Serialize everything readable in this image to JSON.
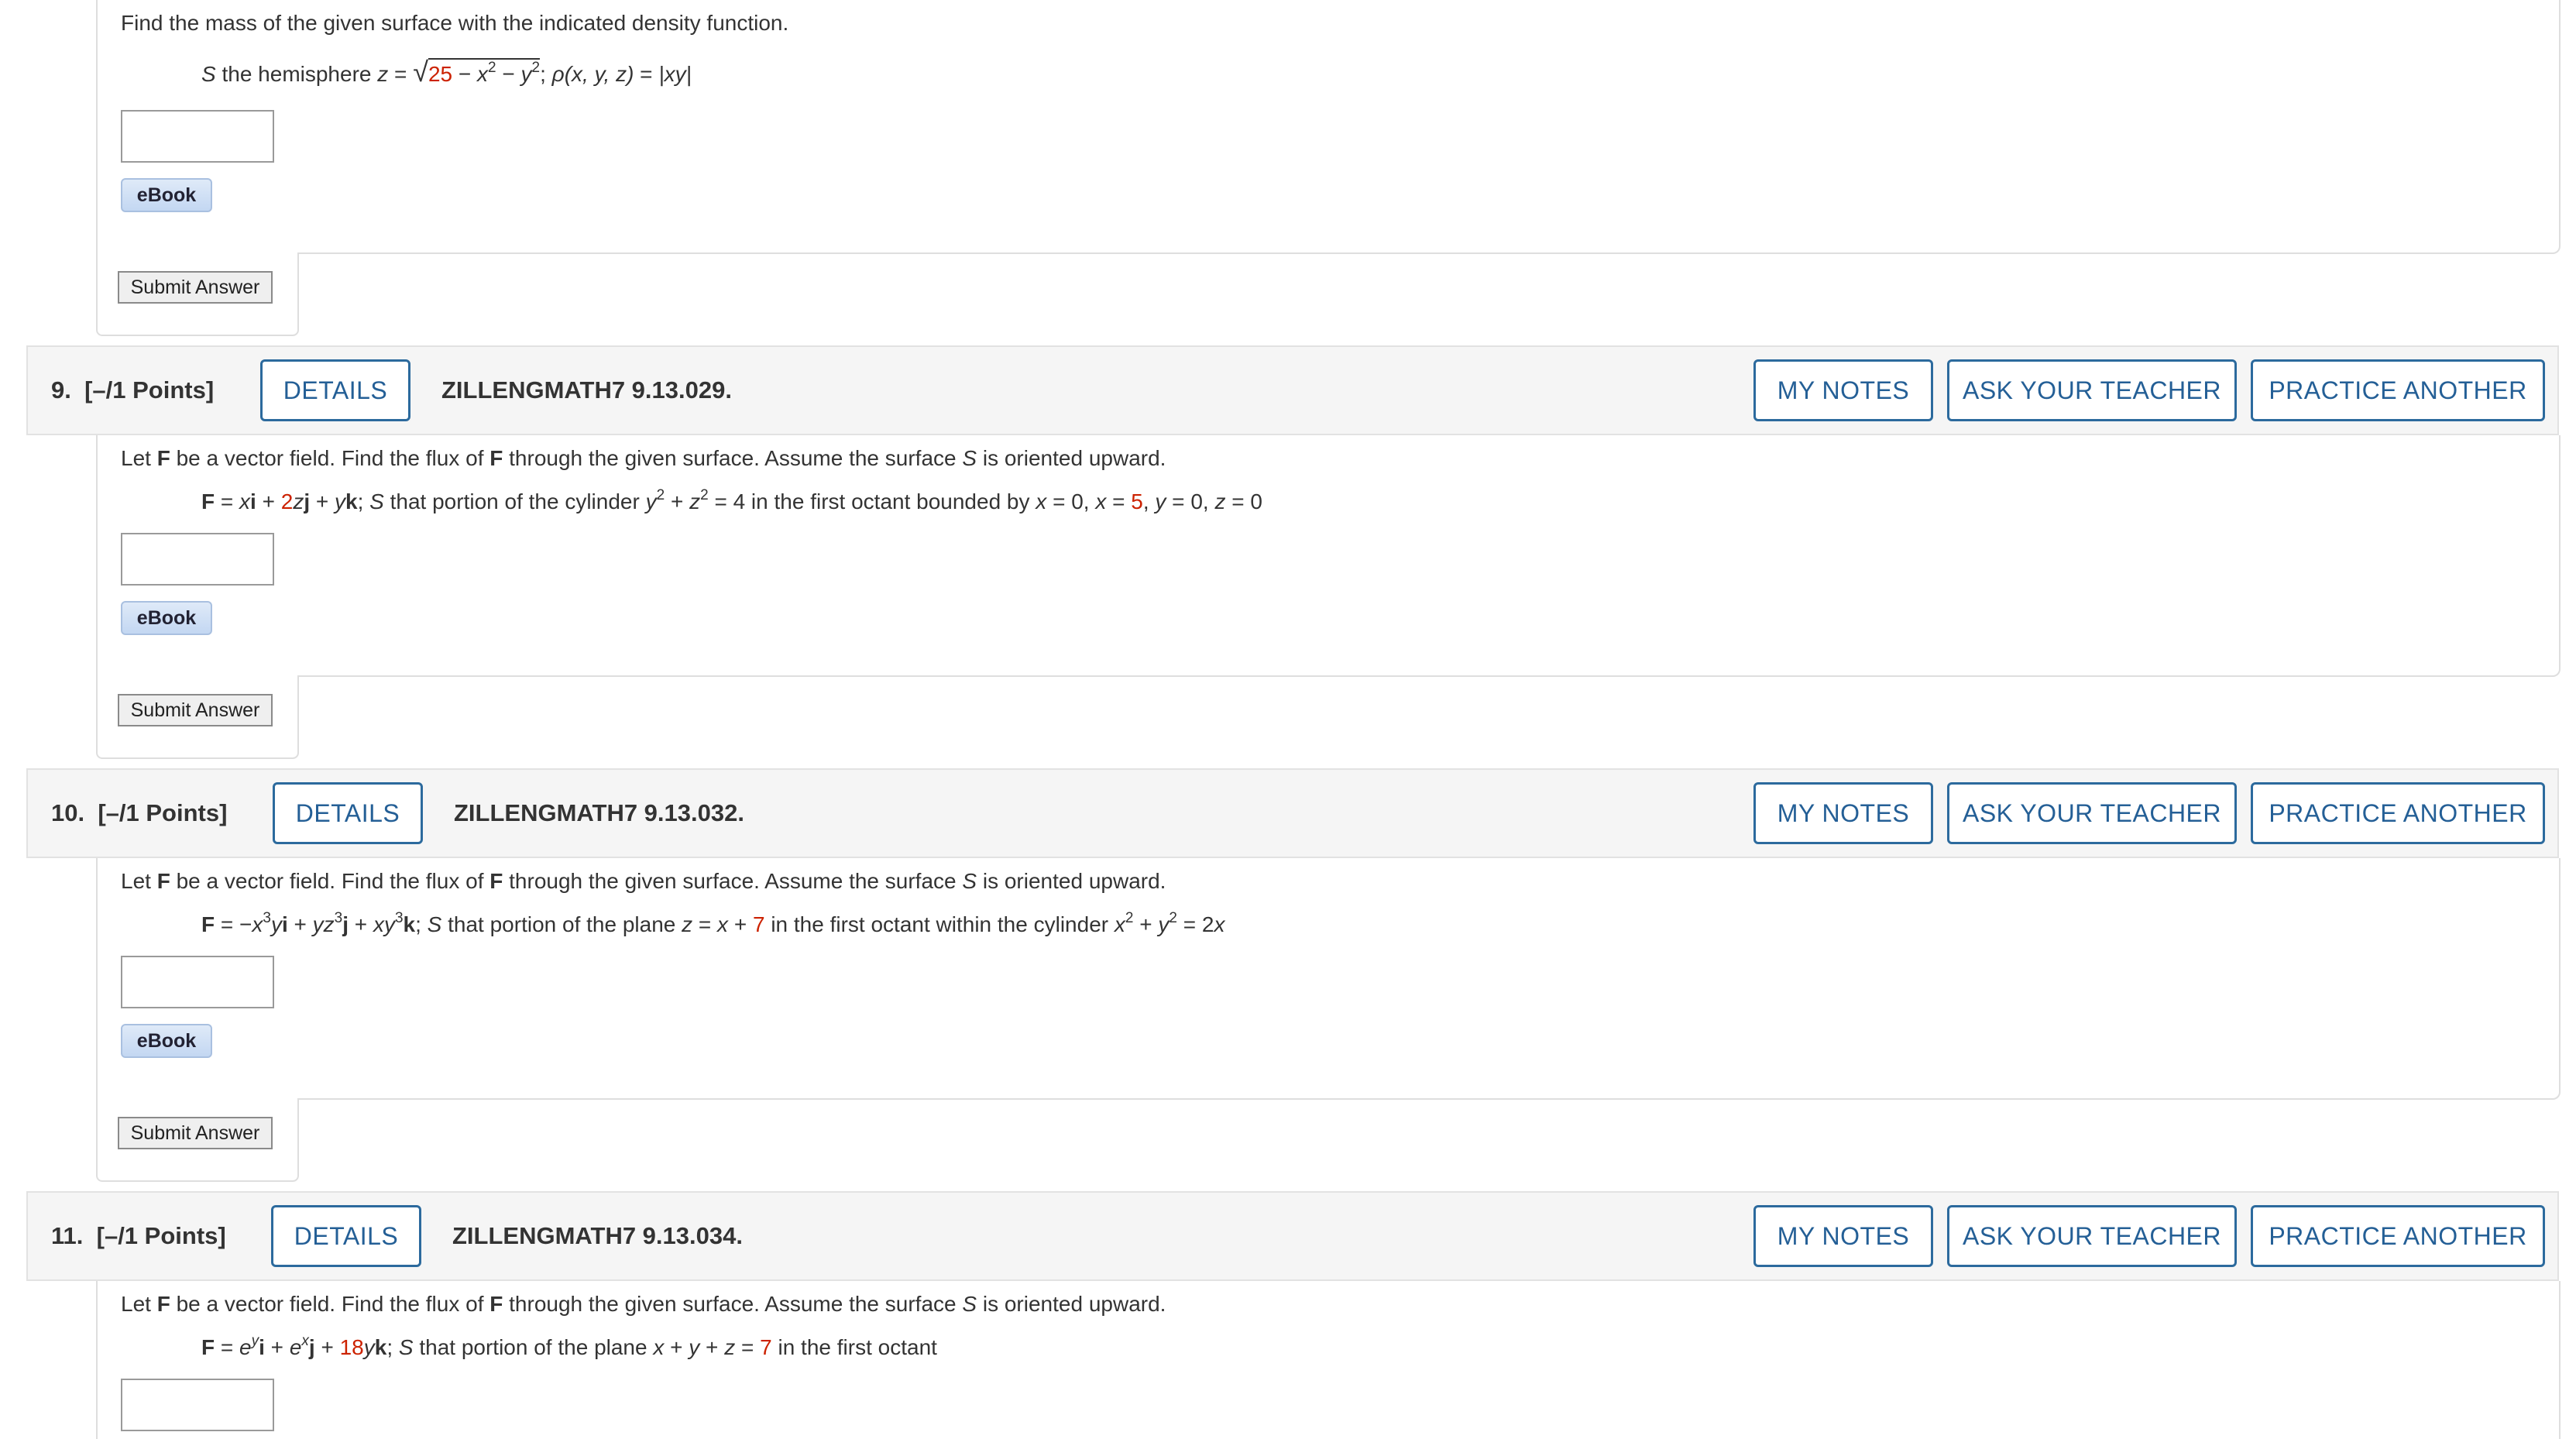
{
  "question8": {
    "prompt": "Find the mass of the given surface with the indicated density function.",
    "formula": {
      "s": "S",
      "lead": " the hemisphere ",
      "z": "z",
      "eq": " = ",
      "radical": "√",
      "n25": "25",
      "minus1": " − ",
      "x": "x",
      "p2a": "2",
      "minus2": " − ",
      "y": "y",
      "p2b": "2",
      "semi": "; ",
      "rho": "ρ",
      "rhoargs": "(x, y, z)",
      "eq2": " = ",
      "abs": "|xy|"
    },
    "ebook_label": "eBook",
    "submit_label": "Submit Answer"
  },
  "question9": {
    "number": "9.",
    "points": "[–/1 Points]",
    "details_label": "DETAILS",
    "code": "ZILLENGMATH7 9.13.029.",
    "my_notes_label": "MY NOTES",
    "ask_teacher_label": "ASK YOUR TEACHER",
    "practice_label": "PRACTICE ANOTHER",
    "prompt_a": "Let ",
    "prompt_F1": "F",
    "prompt_b": " be a vector field. Find the flux of ",
    "prompt_F2": "F",
    "prompt_c": " through the given surface. Assume the surface ",
    "prompt_S": "S",
    "prompt_d": " is oriented upward.",
    "formula": {
      "F": "F",
      "eq": " = ",
      "x": "x",
      "i": "i",
      "plus1": " + ",
      "two": "2",
      "z": "z",
      "j": "j",
      "plus2": " + ",
      "y": "y",
      "k": "k",
      "semi": "; ",
      "S": "S",
      "text1": " that portion of the cylinder ",
      "y2": "y",
      "p2a": "2",
      "plus3": " + ",
      "z2": "z",
      "p2b": "2",
      "text2": " = 4 in the first octant bounded by ",
      "x1": "x",
      "text3": " = 0, ",
      "x2": "x",
      "text4": " = ",
      "five": "5",
      "text5": ", ",
      "y3": "y",
      "text6": " = 0, ",
      "z3": "z",
      "text7": " = 0"
    },
    "ebook_label": "eBook",
    "submit_label": "Submit Answer"
  },
  "question10": {
    "number": "10.",
    "points": "[–/1 Points]",
    "details_label": "DETAILS",
    "code": "ZILLENGMATH7 9.13.032.",
    "my_notes_label": "MY NOTES",
    "ask_teacher_label": "ASK YOUR TEACHER",
    "practice_label": "PRACTICE ANOTHER",
    "prompt_a": "Let ",
    "prompt_F1": "F",
    "prompt_b": " be a vector field. Find the flux of ",
    "prompt_F2": "F",
    "prompt_c": " through the given surface. Assume the surface ",
    "prompt_S": "S",
    "prompt_d": " is oriented upward.",
    "formula": {
      "F": "F",
      "eq": " = −",
      "x": "x",
      "p3a": "3",
      "y": "y",
      "i": "i",
      "plus1": " + ",
      "yz": "yz",
      "p3b": "3",
      "j": "j",
      "plus2": " + ",
      "xy": "xy",
      "p3c": "3",
      "k": "k",
      "semi": "; ",
      "S": "S",
      "text1": " that portion of the plane ",
      "z": "z",
      "text2": " = ",
      "x2": "x",
      "text3": " + ",
      "seven": "7",
      "text4": " in the first octant within the cylinder ",
      "x3": "x",
      "p2a": "2",
      "plus3": " + ",
      "y2": "y",
      "p2b": "2",
      "text5": " = 2",
      "x4": "x"
    },
    "ebook_label": "eBook",
    "submit_label": "Submit Answer"
  },
  "question11": {
    "number": "11.",
    "points": "[–/1 Points]",
    "details_label": "DETAILS",
    "code": "ZILLENGMATH7 9.13.034.",
    "my_notes_label": "MY NOTES",
    "ask_teacher_label": "ASK YOUR TEACHER",
    "practice_label": "PRACTICE ANOTHER",
    "prompt_a": "Let ",
    "prompt_F1": "F",
    "prompt_b": " be a vector field. Find the flux of ",
    "prompt_F2": "F",
    "prompt_c": " through the given surface. Assume the surface ",
    "prompt_S": "S",
    "prompt_d": " is oriented upward.",
    "formula": {
      "F": "F",
      "eq": " = ",
      "e1": "e",
      "y": "y",
      "i": "i",
      "plus1": " + ",
      "e2": "e",
      "x": "x",
      "j": "j",
      "plus2": " + ",
      "eighteen": "18",
      "y2": "y",
      "k": "k",
      "semi": "; ",
      "S": "S",
      "text1": " that portion of the plane ",
      "x2": "x",
      "plus3": " + ",
      "y3": "y",
      "plus4": " + ",
      "z": "z",
      "text2": " = ",
      "seven": "7",
      "text3": " in the first octant"
    }
  }
}
